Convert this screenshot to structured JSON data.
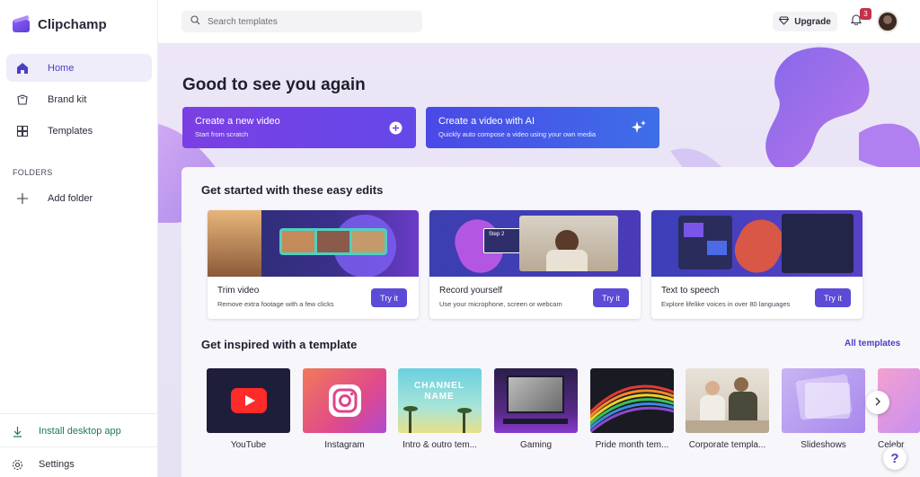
{
  "app": {
    "name": "Clipchamp"
  },
  "sidebar": {
    "items": [
      {
        "label": "Home",
        "icon": "home-icon",
        "active": true
      },
      {
        "label": "Brand kit",
        "icon": "brand-kit-icon",
        "active": false
      },
      {
        "label": "Templates",
        "icon": "templates-icon",
        "active": false
      }
    ],
    "folders_heading": "FOLDERS",
    "add_folder": "Add folder",
    "install": "Install desktop app",
    "settings": "Settings"
  },
  "topbar": {
    "search_placeholder": "Search templates",
    "upgrade": "Upgrade",
    "notifications": "3"
  },
  "main": {
    "greeting": "Good to see you again",
    "actions": [
      {
        "title": "Create a new video",
        "subtitle": "Start from scratch",
        "icon": "plus-circle-icon"
      },
      {
        "title": "Create a video with AI",
        "subtitle": "Quickly auto compose a video using your own media",
        "icon": "sparkle-icon"
      }
    ],
    "edits_heading": "Get started with these easy edits",
    "edits": [
      {
        "title": "Trim video",
        "desc": "Remove extra footage with a few clicks",
        "button": "Try it"
      },
      {
        "title": "Record yourself",
        "desc": "Use your microphone, screen or webcam",
        "button": "Try it",
        "thumb_label": "Step 2"
      },
      {
        "title": "Text to speech",
        "desc": "Explore lifelike voices in over 80 languages",
        "button": "Try it"
      }
    ],
    "templates_heading": "Get inspired with a template",
    "all_templates": "All templates",
    "templates": [
      {
        "label": "YouTube"
      },
      {
        "label": "Instagram"
      },
      {
        "label": "Intro & outro tem...",
        "thumb_text": "CHANNEL NAME"
      },
      {
        "label": "Gaming"
      },
      {
        "label": "Pride month tem..."
      },
      {
        "label": "Corporate templa..."
      },
      {
        "label": "Slideshows"
      },
      {
        "label": "Celebr"
      }
    ]
  },
  "help": "?",
  "colors": {
    "accent": "#5b4bd6",
    "accent_text": "#4b3fc7",
    "install_green": "#1d7a5a",
    "badge_red": "#c4314b"
  }
}
